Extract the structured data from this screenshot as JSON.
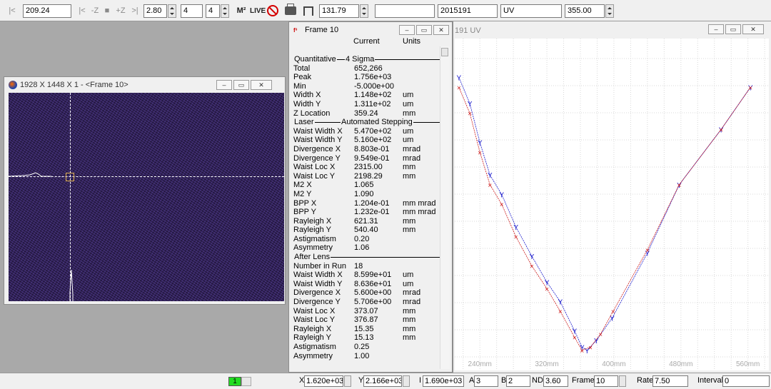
{
  "toolbar": {
    "field1": "209.24",
    "nav_buttons": [
      "|<",
      "-Z",
      "■",
      "+Z",
      ">|"
    ],
    "spin1": "2.80",
    "spin2": "4",
    "spin3": "4",
    "m2_label": "M²",
    "live_label": "LIVE",
    "field_z": "131.79",
    "field_blank": "",
    "serial": "2015191",
    "mode": "UV",
    "wavelength": "355.00"
  },
  "image_window": {
    "title": "1928 X 1448 X 1 - <Frame 10>"
  },
  "frame_panel": {
    "title": "Frame 10",
    "col_current": "Current",
    "col_units": "Units",
    "sections": [
      {
        "header": "Quantitative",
        "rows": [
          {
            "label": "Total",
            "value": "652,266",
            "unit": ""
          },
          {
            "label": "Peak",
            "value": "1.756e+03",
            "unit": ""
          },
          {
            "label": "Min",
            "value": "-5.000e+00",
            "unit": ""
          },
          {
            "label": "Width X",
            "value": "1.148e+02",
            "unit": "um"
          },
          {
            "label": "Width Y",
            "value": "1.311e+02",
            "unit": "um"
          },
          {
            "label": "Z Location",
            "value": "359.24",
            "unit": "mm"
          }
        ]
      },
      {
        "header": "Laser",
        "rows": [
          {
            "label": "Waist Width X",
            "value": "5.470e+02",
            "unit": "um"
          },
          {
            "label": "Waist Width Y",
            "value": "5.160e+02",
            "unit": "um"
          },
          {
            "label": "Divergence X",
            "value": "8.803e-01",
            "unit": "mrad"
          },
          {
            "label": "Divergence Y",
            "value": "9.549e-01",
            "unit": "mrad"
          },
          {
            "label": "Waist Loc X",
            "value": "2315.00",
            "unit": "mm"
          },
          {
            "label": "Waist Loc Y",
            "value": "2198.29",
            "unit": "mm"
          },
          {
            "label": "M2 X",
            "value": "1.065",
            "unit": ""
          },
          {
            "label": "M2 Y",
            "value": "1.090",
            "unit": ""
          },
          {
            "label": "BPP X",
            "value": "1.204e-01",
            "unit": "mm mrad"
          },
          {
            "label": "BPP Y",
            "value": "1.232e-01",
            "unit": "mm mrad"
          },
          {
            "label": "Rayleigh X",
            "value": "621.31",
            "unit": "mm"
          },
          {
            "label": "Rayleigh Y",
            "value": "540.40",
            "unit": "mm"
          },
          {
            "label": "Astigmatism",
            "value": "0.20",
            "unit": ""
          },
          {
            "label": "Asymmetry",
            "value": "1.06",
            "unit": ""
          }
        ]
      },
      {
        "header": "After Lens",
        "rows": [
          {
            "label": "Number in Run",
            "value": "18",
            "unit": ""
          },
          {
            "label": "Waist Width X",
            "value": "8.599e+01",
            "unit": "um"
          },
          {
            "label": "Waist Width Y",
            "value": "8.636e+01",
            "unit": "um"
          },
          {
            "label": "Divergence X",
            "value": "5.600e+00",
            "unit": "mrad"
          },
          {
            "label": "Divergence Y",
            "value": "5.706e+00",
            "unit": "mrad"
          },
          {
            "label": "Waist Loc X",
            "value": "373.07",
            "unit": "mm"
          },
          {
            "label": "Waist Loc Y",
            "value": "376.87",
            "unit": "mm"
          },
          {
            "label": "Rayleigh X",
            "value": "15.35",
            "unit": "mm"
          },
          {
            "label": "Rayleigh Y",
            "value": "15.13",
            "unit": "mm"
          },
          {
            "label": "Astigmatism",
            "value": "0.25",
            "unit": ""
          },
          {
            "label": "Asymmetry",
            "value": "1.00",
            "unit": ""
          }
        ]
      }
    ],
    "quant_suffix": "4 Sigma",
    "laser_suffix": "Automated Stepping"
  },
  "chart_window": {
    "title_fragment": "191 UV",
    "x_ticks": [
      "240mm",
      "320mm",
      "400mm",
      "480mm",
      "560mm"
    ]
  },
  "chart_data": {
    "type": "scatter",
    "x_ticks": [
      240,
      320,
      400,
      480,
      560
    ],
    "xlim": [
      210,
      585
    ],
    "ylim": [
      0,
      1
    ],
    "series": [
      {
        "marker": "y",
        "color": "#1a1acc",
        "points": [
          [
            215,
            0.88
          ],
          [
            228,
            0.8
          ],
          [
            240,
            0.68
          ],
          [
            252,
            0.58
          ],
          [
            266,
            0.52
          ],
          [
            283,
            0.42
          ],
          [
            302,
            0.33
          ],
          [
            320,
            0.25
          ],
          [
            336,
            0.19
          ],
          [
            353,
            0.1
          ],
          [
            362,
            0.05
          ],
          [
            368,
            0.04
          ],
          [
            379,
            0.07
          ],
          [
            398,
            0.14
          ],
          [
            440,
            0.34
          ],
          [
            478,
            0.55
          ],
          [
            528,
            0.72
          ],
          [
            563,
            0.85
          ]
        ]
      },
      {
        "marker": "x",
        "color": "#cc1a1a",
        "points": [
          [
            215,
            0.85
          ],
          [
            228,
            0.77
          ],
          [
            240,
            0.65
          ],
          [
            252,
            0.55
          ],
          [
            266,
            0.49
          ],
          [
            283,
            0.39
          ],
          [
            302,
            0.3
          ],
          [
            320,
            0.23
          ],
          [
            336,
            0.16
          ],
          [
            353,
            0.08
          ],
          [
            362,
            0.04
          ],
          [
            372,
            0.05
          ],
          [
            384,
            0.09
          ],
          [
            399,
            0.16
          ],
          [
            440,
            0.35
          ],
          [
            478,
            0.55
          ],
          [
            528,
            0.72
          ],
          [
            563,
            0.85
          ]
        ]
      }
    ]
  },
  "status_bar": {
    "indicator": "1",
    "x_label": "X",
    "x_value": "1.620e+03",
    "y_label": "Y",
    "y_value": "2.166e+03",
    "i_label": "I",
    "i_value": "1.690e+03",
    "a_label": "A",
    "a_value": "3",
    "b_label": "B",
    "b_value": "2",
    "nd_label": "ND",
    "nd_value": "3.60",
    "frame_label": "Frame",
    "frame_value": "10",
    "rate_label": "Rate",
    "rate_value": "7.50",
    "interval_label": "Interval",
    "interval_value": "0"
  }
}
